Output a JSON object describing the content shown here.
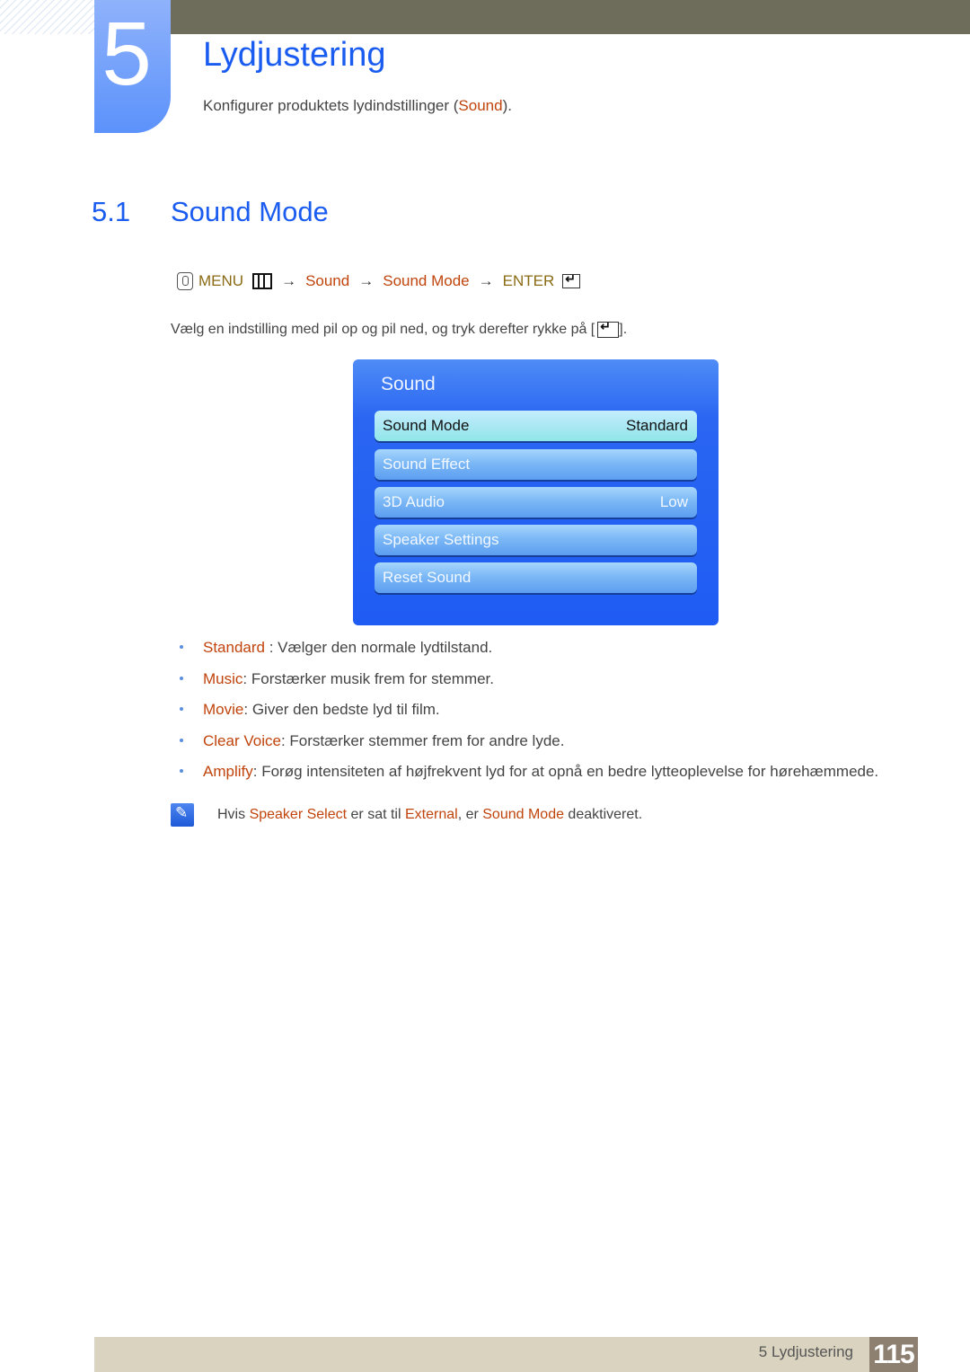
{
  "header": {
    "chapter_number": "5",
    "chapter_title": "Lydjustering",
    "subtitle_prefix": "Konfigurer produktets lydindstillinger (",
    "subtitle_highlight": "Sound",
    "subtitle_suffix": ")."
  },
  "section": {
    "number": "5.1",
    "title": "Sound Mode"
  },
  "menu_path": {
    "menu_label": "MENU",
    "arrow": "→",
    "steps": [
      "Sound",
      "Sound Mode"
    ],
    "enter_label": "ENTER"
  },
  "instruction": {
    "text": "Vælg en indstilling med pil op og pil ned, og tryk derefter rykke på [",
    "suffix": "]."
  },
  "osd": {
    "title": "Sound",
    "items": [
      {
        "label": "Sound Mode",
        "value": "Standard",
        "selected": true
      },
      {
        "label": "Sound Effect",
        "value": ""
      },
      {
        "label": "3D Audio",
        "value": "Low"
      },
      {
        "label": "Speaker Settings",
        "value": ""
      },
      {
        "label": "Reset Sound",
        "value": ""
      }
    ]
  },
  "bullets": [
    {
      "term": "Standard",
      "sep": " : ",
      "desc": "Vælger den normale lydtilstand."
    },
    {
      "term": "Music",
      "sep": ": ",
      "desc": "Forstærker musik frem for stemmer."
    },
    {
      "term": "Movie",
      "sep": ": ",
      "desc": "Giver den bedste lyd til film."
    },
    {
      "term": "Clear Voice",
      "sep": ": ",
      "desc": "Forstærker stemmer frem for andre lyde."
    },
    {
      "term": "Amplify",
      "sep": ": ",
      "desc": "Forøg intensiteten af højfrekvent lyd for at opnå en bedre lytteoplevelse for hørehæmmede."
    }
  ],
  "note": {
    "t1": "Hvis ",
    "h1": "Speaker Select",
    "t2": " er sat til ",
    "h2": "External",
    "t3": ", er ",
    "h3": "Sound Mode",
    "t4": " deaktiveret."
  },
  "footer": {
    "chapter_label": "5 Lydjustering",
    "page_number": "115"
  },
  "colors": {
    "heading_blue": "#1a5cf0",
    "highlight_orange": "#c0440c",
    "menu_gold": "#8a6a14",
    "osd_blue": "#1f5cf3"
  }
}
